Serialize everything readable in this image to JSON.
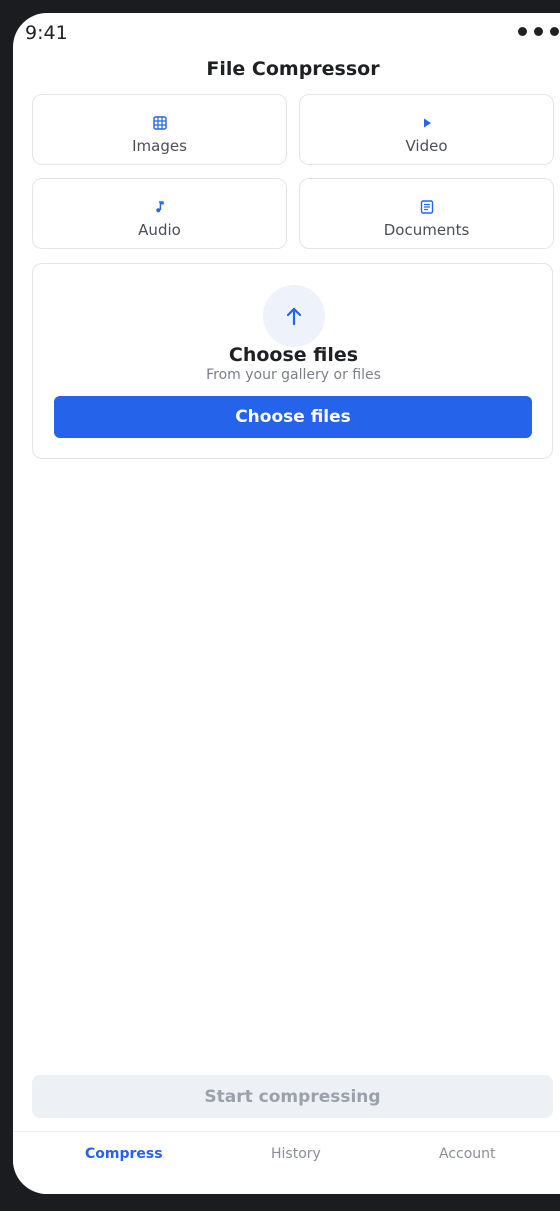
{
  "status_bar": {
    "time": "9:41"
  },
  "header": {
    "title": "File Compressor"
  },
  "categories": [
    {
      "label": "Images",
      "icon": "grid-icon"
    },
    {
      "label": "Video",
      "icon": "play-icon"
    },
    {
      "label": "Audio",
      "icon": "music-note-icon"
    },
    {
      "label": "Documents",
      "icon": "document-icon"
    }
  ],
  "upload": {
    "heading": "Choose files",
    "subtitle": "From your gallery or files",
    "button_label": "Choose files"
  },
  "start_button": {
    "label": "Start compressing"
  },
  "tabs": [
    {
      "label": "Compress",
      "active": true
    },
    {
      "label": "History",
      "active": false
    },
    {
      "label": "Account",
      "active": false
    }
  ],
  "colors": {
    "accent": "#2563eb",
    "disabled_bg": "#edf0f4",
    "disabled_text": "#9ba1ab"
  }
}
